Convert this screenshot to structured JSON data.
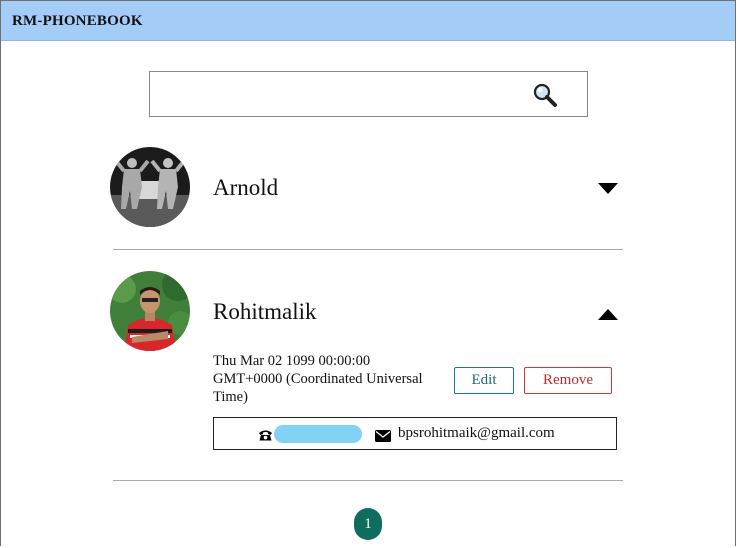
{
  "app": {
    "title": "RM-PHONEBOOK"
  },
  "search": {
    "value": "",
    "placeholder": "",
    "icon": "search-icon"
  },
  "contacts": [
    {
      "name": "Arnold",
      "expanded": false,
      "toggle_icon": "caret-down-icon"
    },
    {
      "name": "Rohitmalik",
      "expanded": true,
      "toggle_icon": "caret-up-icon",
      "date_line1": "Thu Mar 02 1099 00:00:00",
      "date_line2": "GMT+0000 (Coordinated Universal",
      "date_line3": "Time)",
      "edit_label": "Edit",
      "remove_label": "Remove",
      "email": "bpsrohitmaik@gmail.com"
    }
  ],
  "pagination": {
    "current": "1"
  },
  "colors": {
    "header": "#a3cdf6",
    "accent": "#0e6d5d",
    "edit": "#1a7f7a",
    "remove": "#d23a3a",
    "phone_redaction": "#82d2f6"
  }
}
